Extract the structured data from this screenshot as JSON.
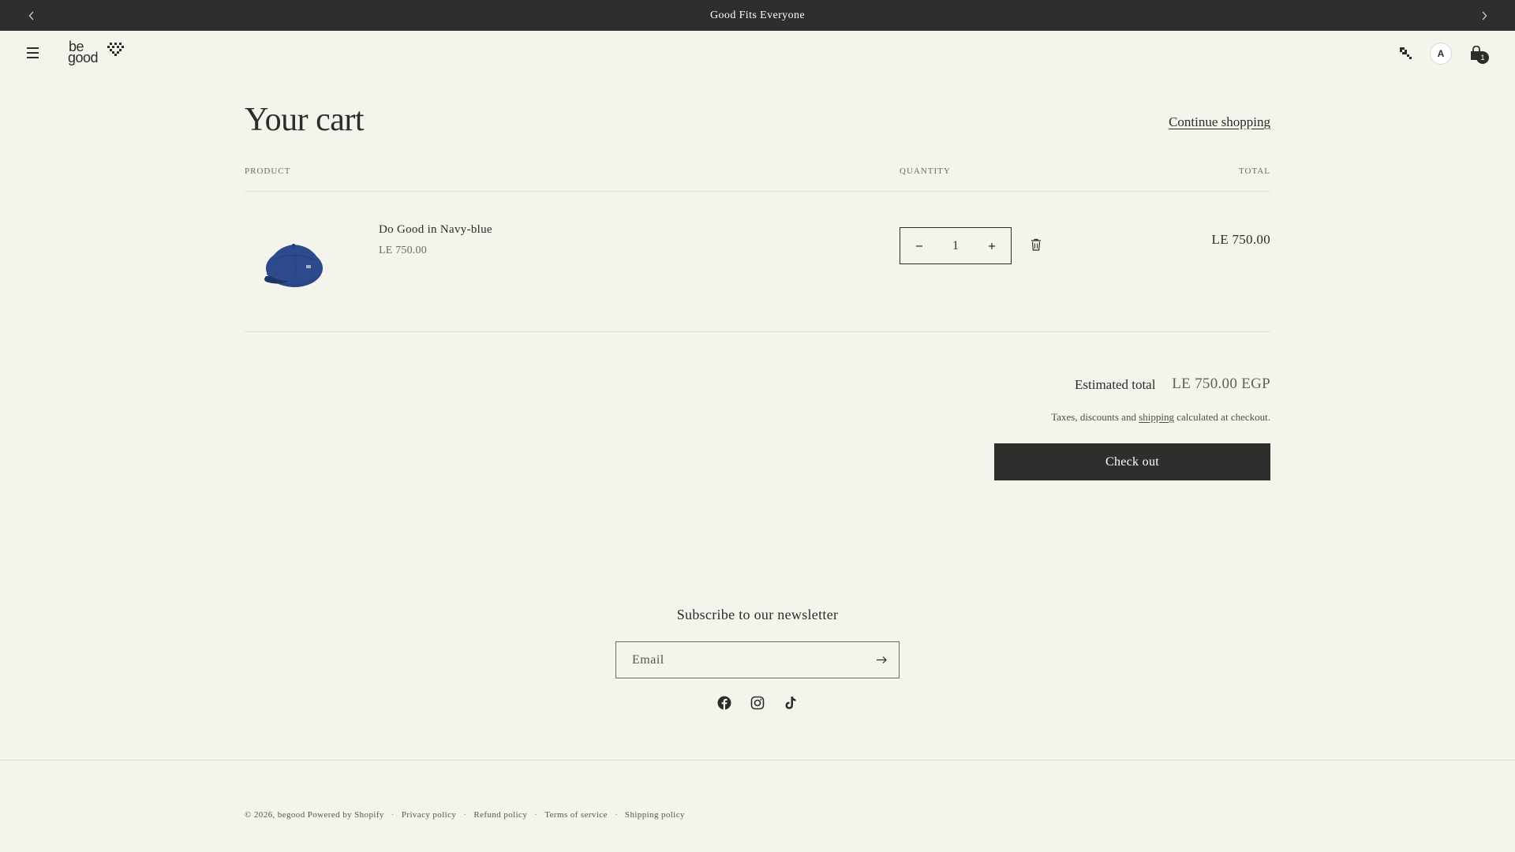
{
  "announcement": {
    "text": "Good Fits Everyone",
    "prev_icon": "chevron-left-icon",
    "next_icon": "chevron-right-icon"
  },
  "header": {
    "logo_top": "be",
    "logo_bottom": "good",
    "account_initial": "A",
    "cart_count": "1",
    "icons": [
      "menu-icon",
      "search-icon",
      "cart-icon"
    ]
  },
  "cart": {
    "title": "Your cart",
    "continue_label": "Continue shopping",
    "columns": {
      "product": "PRODUCT",
      "quantity": "QUANTITY",
      "total": "TOTAL"
    },
    "items": [
      {
        "name": "Do Good in Navy-blue",
        "price": "LE 750.00",
        "quantity": "1",
        "line_total": "LE 750.00",
        "image": "navy-cap-image"
      }
    ],
    "estimated_label": "Estimated total",
    "estimated_value": "LE 750.00 EGP",
    "tax_note_before": "Taxes, discounts and",
    "tax_note_link": "shipping",
    "tax_note_after": "calculated at checkout.",
    "checkout_label": "Check out"
  },
  "newsletter": {
    "title": "Subscribe to our newsletter",
    "email_placeholder": "Email",
    "email_value": "",
    "socials": [
      "facebook-icon",
      "instagram-icon",
      "tiktok-icon"
    ]
  },
  "footer": {
    "copyright": "© 2026, begood",
    "powered": "Powered by Shopify",
    "links": [
      "Privacy policy",
      "Refund policy",
      "Terms of service",
      "Shipping policy"
    ],
    "separator": "·"
  },
  "colors": {
    "background": "#f4f3ec",
    "dark": "#2e2e2c",
    "text": "#2c2c2a",
    "muted": "#6b6b66",
    "cap_navy": "#2d4b8c"
  }
}
